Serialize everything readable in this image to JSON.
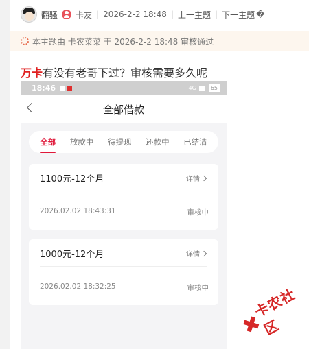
{
  "header": {
    "author": "翻骚",
    "role": "卡友",
    "datetime": "2026-2-2 18:48",
    "prev_topic": "上一主题",
    "next_topic": "下一主题",
    "next_glyph": "�"
  },
  "notice": {
    "text": "本主题由 卡农菜菜 于 2026-2-2 18:48 审核通过"
  },
  "post": {
    "tag": "万卡",
    "title": "有没有老哥下过？审核需要多久呢"
  },
  "phone": {
    "statusbar": {
      "time": "18:46",
      "battery": "65",
      "network": "4G"
    },
    "nav_title": "全部借款",
    "tabs": [
      "全部",
      "放款中",
      "待提现",
      "还款中",
      "已结清"
    ],
    "active_tab": 0,
    "loans": [
      {
        "title": "1100元-12个月",
        "detail": "详情",
        "time": "2026.02.02 18:43:31",
        "status": "审核中"
      },
      {
        "title": "1000元-12个月",
        "detail": "详情",
        "time": "2026.02.02 18:32:25",
        "status": "审核中"
      }
    ]
  },
  "watermark": {
    "text": "卡农社区",
    "color": "#d62828"
  },
  "colors": {
    "accent_red": "#e0183a",
    "notice_bg": "#fdf6ee"
  }
}
